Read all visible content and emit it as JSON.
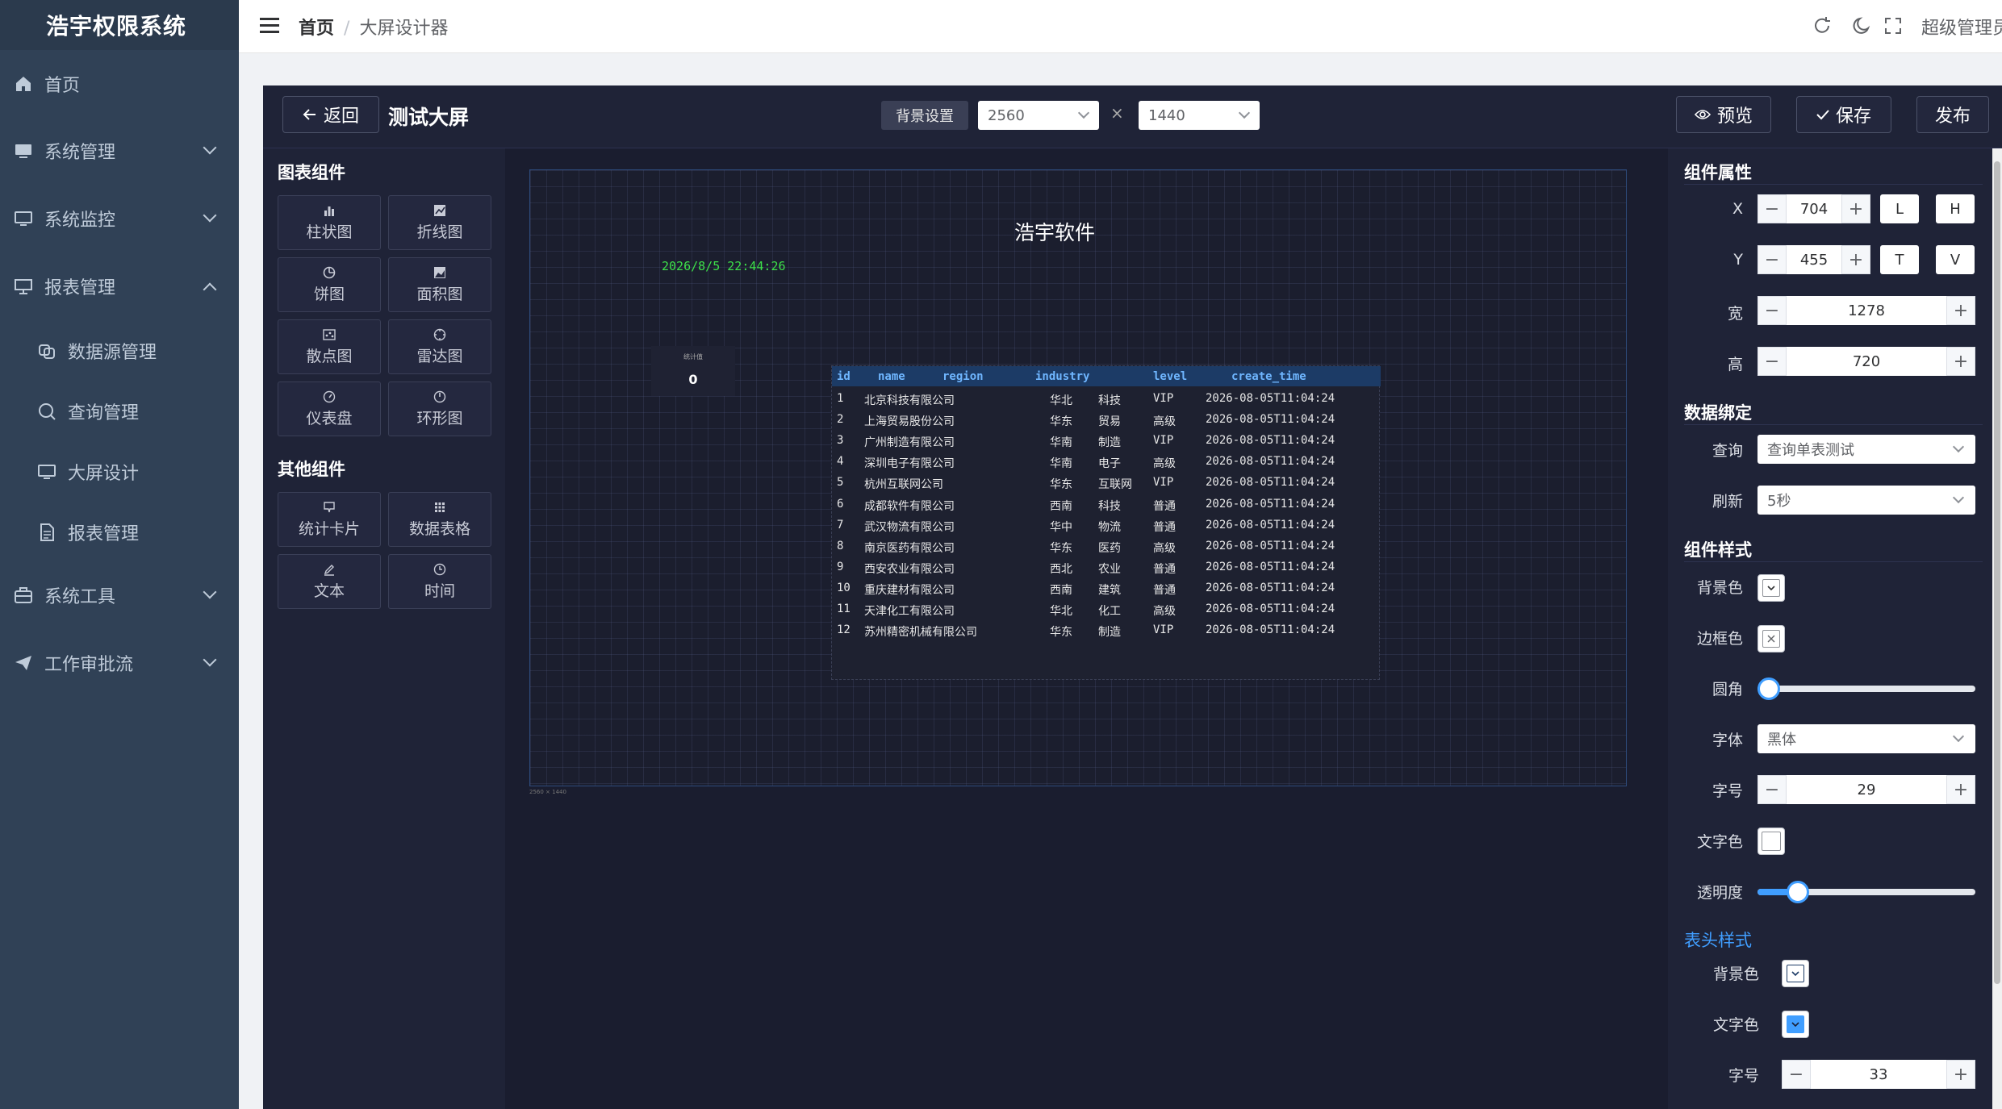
{
  "app": {
    "title": "浩宇权限系统"
  },
  "sidebar": {
    "items": [
      {
        "label": "首页",
        "icon": "home-icon"
      },
      {
        "label": "系统管理",
        "icon": "monitor-icon"
      },
      {
        "label": "系统监控",
        "icon": "screen-icon"
      },
      {
        "label": "报表管理",
        "icon": "presentation-icon",
        "expanded": true
      },
      {
        "label": "系统工具",
        "icon": "toolbox-icon"
      },
      {
        "label": "工作审批流",
        "icon": "send-icon"
      }
    ],
    "sub_items": [
      {
        "label": "数据源管理",
        "icon": "datasource-icon"
      },
      {
        "label": "查询管理",
        "icon": "search-icon"
      },
      {
        "label": "大屏设计",
        "icon": "screen-icon"
      },
      {
        "label": "报表管理",
        "icon": "document-icon"
      }
    ]
  },
  "header": {
    "breadcrumb_home": "首页",
    "breadcrumb_sep": "/",
    "breadcrumb_current": "大屏设计器",
    "user": "超级管理员"
  },
  "designer": {
    "back_label": "返回",
    "title": "测试大屏",
    "bg_settings": "背景设置",
    "width": "2560",
    "height": "1440",
    "times": "×",
    "preview_label": "预览",
    "save_label": "保存",
    "publish_label": "发布"
  },
  "left_panel": {
    "chart_section": "图表组件",
    "chart_components": [
      "柱状图",
      "折线图",
      "饼图",
      "面积图",
      "散点图",
      "雷达图",
      "仪表盘",
      "环形图"
    ],
    "other_section": "其他组件",
    "other_components": [
      "统计卡片",
      "数据表格",
      "文本",
      "时间"
    ]
  },
  "canvas": {
    "size_label": "2560 × 1440",
    "title": "浩宇软件",
    "time": "2026/8/5 22:44:26",
    "stat_card": {
      "title": "统计值",
      "value": "0"
    },
    "table": {
      "columns": [
        "id",
        "name",
        "region",
        "industry",
        "level",
        "create_time"
      ],
      "rows": [
        [
          "1",
          "北京科技有限公司",
          "华北",
          "科技",
          "VIP",
          "2026-08-05T11:04:24"
        ],
        [
          "2",
          "上海贸易股份公司",
          "华东",
          "贸易",
          "高级",
          "2026-08-05T11:04:24"
        ],
        [
          "3",
          "广州制造有限公司",
          "华南",
          "制造",
          "VIP",
          "2026-08-05T11:04:24"
        ],
        [
          "4",
          "深圳电子有限公司",
          "华南",
          "电子",
          "高级",
          "2026-08-05T11:04:24"
        ],
        [
          "5",
          "杭州互联网公司",
          "华东",
          "互联网",
          "VIP",
          "2026-08-05T11:04:24"
        ],
        [
          "6",
          "成都软件有限公司",
          "西南",
          "科技",
          "普通",
          "2026-08-05T11:04:24"
        ],
        [
          "7",
          "武汉物流有限公司",
          "华中",
          "物流",
          "普通",
          "2026-08-05T11:04:24"
        ],
        [
          "8",
          "南京医药有限公司",
          "华东",
          "医药",
          "高级",
          "2026-08-05T11:04:24"
        ],
        [
          "9",
          "西安农业有限公司",
          "西北",
          "农业",
          "普通",
          "2026-08-05T11:04:24"
        ],
        [
          "10",
          "重庆建材有限公司",
          "西南",
          "建筑",
          "普通",
          "2026-08-05T11:04:24"
        ],
        [
          "11",
          "天津化工有限公司",
          "华北",
          "化工",
          "高级",
          "2026-08-05T11:04:24"
        ],
        [
          "12",
          "苏州精密机械有限公司",
          "华东",
          "制造",
          "VIP",
          "2026-08-05T11:04:24"
        ]
      ]
    }
  },
  "props": {
    "section_props": "组件属性",
    "x_label": "X",
    "x": "704",
    "y_label": "Y",
    "y": "455",
    "w_label": "宽",
    "w": "1278",
    "h_label": "高",
    "h": "720",
    "btn_l": "L",
    "btn_h": "H",
    "btn_t": "T",
    "btn_v": "V",
    "section_data": "数据绑定",
    "query_label": "查询",
    "query_value": "查询单表测试",
    "refresh_label": "刷新",
    "refresh_value": "5秒",
    "section_style": "组件样式",
    "bg_color_label": "背景色",
    "border_color_label": "边框色",
    "radius_label": "圆角",
    "radius_value": 0,
    "font_label": "字体",
    "font_value": "黑体",
    "size_label": "字号",
    "size_value": "29",
    "text_color_label": "文字色",
    "opacity_label": "透明度",
    "opacity_value": 0.15,
    "header_style": "表头样式",
    "header_bg_label": "背景色",
    "header_text_label": "文字色",
    "header_size_label": "字号",
    "header_size_value": "33"
  },
  "colors": {
    "sidebar_bg": "#304156",
    "designer_bg": "#1b1e32",
    "accent": "#409eff",
    "table_header": "#1c3b66",
    "time_green": "#3de04a"
  }
}
